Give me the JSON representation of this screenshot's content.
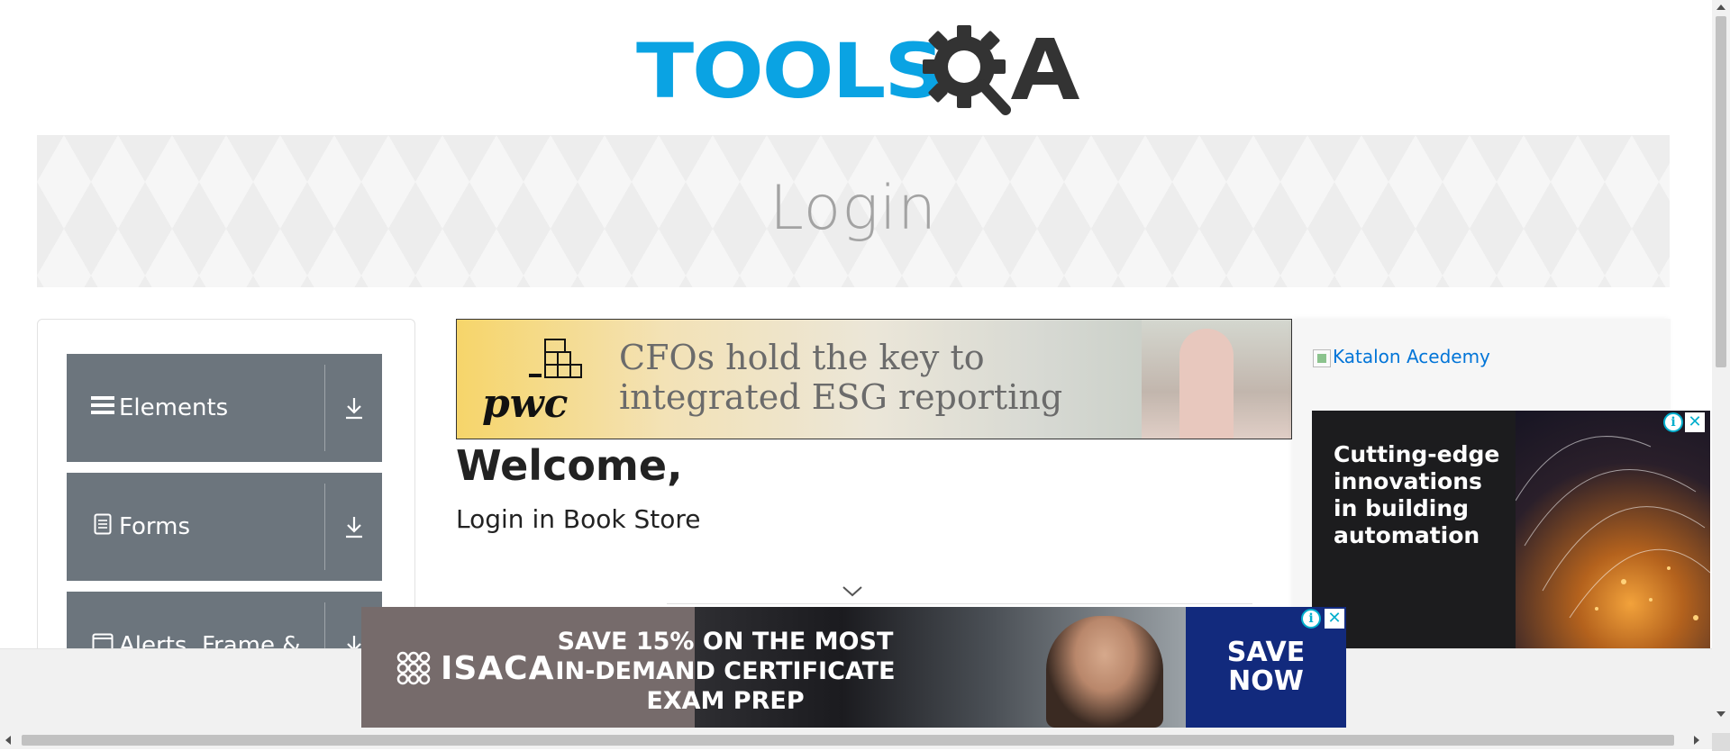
{
  "header": {
    "logo_text": "TOOLSQA"
  },
  "banner": {
    "title": "Login"
  },
  "sidebar": {
    "groups": [
      {
        "label": "Elements",
        "icon": "hamburger-icon"
      },
      {
        "label": "Forms",
        "icon": "document-icon"
      },
      {
        "label": "Alerts, Frame &",
        "icon": "window-icon"
      }
    ]
  },
  "ads": {
    "pwc": {
      "logo": "pwc",
      "line1": "CFOs hold the key to",
      "line2": "integrated ESG reporting"
    },
    "katalon": {
      "alt": "Katalon Acedemy"
    },
    "side": {
      "line1": "Cutting-edge",
      "line2": "innovations",
      "line3": "in building",
      "line4": "automation"
    },
    "isaca": {
      "logo": "ISACA",
      "line1": "SAVE 15% ON THE MOST",
      "line2": "IN-DEMAND CERTIFICATE",
      "line3": "EXAM PREP",
      "cta_line1": "SAVE",
      "cta_line2": "NOW"
    }
  },
  "main": {
    "welcome": "Welcome,",
    "subtitle": "Login in Book Store"
  },
  "colors": {
    "logo_blue": "#0aa3e3",
    "logo_dark": "#333333",
    "group_bg": "#6c757d",
    "link": "#0275d8",
    "isaca_cta": "#122a7d"
  }
}
